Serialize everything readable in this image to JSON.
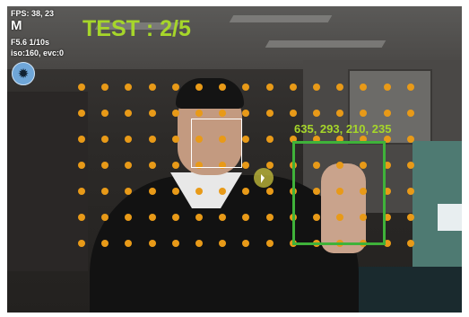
{
  "hud": {
    "fps": "FPS: 38, 23",
    "mode": "M",
    "aperture_shutter": "F5.6 1/10s",
    "iso_evc": "iso:160, evc:0",
    "flash_icon": "sun-icon"
  },
  "test": {
    "label": "TEST : 2/5"
  },
  "hand_box": {
    "coords": "635, 293, 210, 235"
  },
  "colors": {
    "accent_green": "#a6d62a",
    "box_green": "#3fb23a",
    "dot_orange": "#e89a18"
  }
}
